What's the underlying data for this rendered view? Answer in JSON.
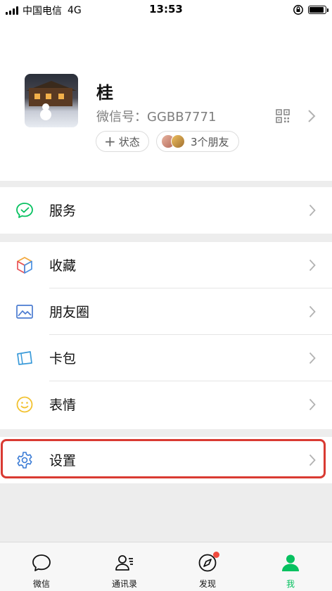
{
  "status_bar": {
    "carrier": "中国电信",
    "network": "4G",
    "time": "13:53"
  },
  "profile": {
    "nickname": "桂",
    "wechat_id": "微信号：GGBB7771",
    "status_pill": "状态",
    "status_plus": "+",
    "friends_pill": "3个朋友"
  },
  "menu": {
    "service": {
      "label": "服务",
      "icon": "service-icon"
    },
    "items": [
      {
        "label": "收藏",
        "icon": "favorites-cube-icon"
      },
      {
        "label": "朋友圈",
        "icon": "moments-image-icon"
      },
      {
        "label": "卡包",
        "icon": "card-wallet-icon"
      },
      {
        "label": "表情",
        "icon": "emoji-smiley-icon"
      }
    ],
    "settings": {
      "label": "设置",
      "icon": "gear-icon"
    }
  },
  "tabbar": {
    "tabs": [
      {
        "label": "微信",
        "icon": "chat-bubble-icon"
      },
      {
        "label": "通讯录",
        "icon": "contacts-icon"
      },
      {
        "label": "发现",
        "icon": "compass-icon"
      },
      {
        "label": "我",
        "icon": "person-icon"
      }
    ],
    "active_tab": "我"
  },
  "colors": {
    "accent": "#07c160",
    "highlight": "#d93a32",
    "background": "#ededed"
  }
}
